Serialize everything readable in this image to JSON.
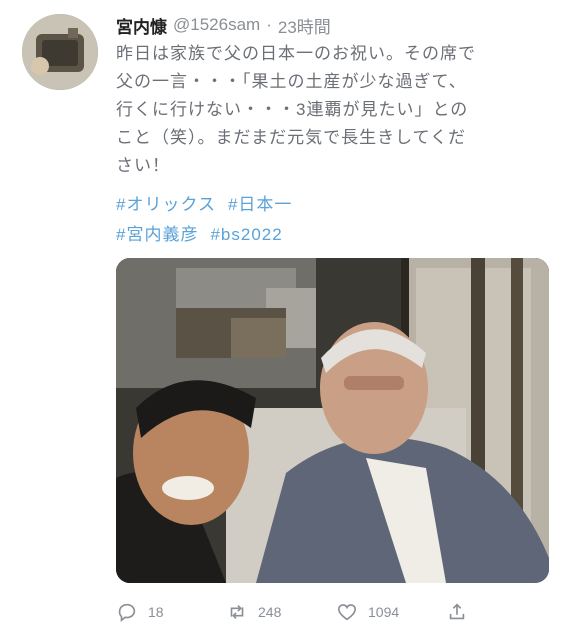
{
  "header": {
    "display_name": "宮内慷",
    "handle": "@1526sam",
    "separator": "·",
    "time": "23時間"
  },
  "tweet": {
    "lines": [
      "昨日は家族で父の日本一のお祝い。その席で",
      "父の一言・・・「果土の土産が少な過ぎて、",
      "行くに行けない・・・3連覇が見たい」との",
      "こと（笑）。まだまだ元気で長生きしてくだ",
      "さい！"
    ],
    "hashtags_row1": [
      "#オリックス",
      "#日本一"
    ],
    "hashtags_row2": [
      "#宮内義彦",
      "#bs2022"
    ]
  },
  "actions": {
    "reply_icon": "reply-icon",
    "reply_count": "18",
    "retweet_icon": "retweet-icon",
    "retweet_count": "248",
    "like_icon": "heart-icon",
    "like_count": "1094",
    "share_icon": "share-icon"
  },
  "colors": {
    "hashtag": "#5aa2d8",
    "muted": "#8a8f96"
  }
}
